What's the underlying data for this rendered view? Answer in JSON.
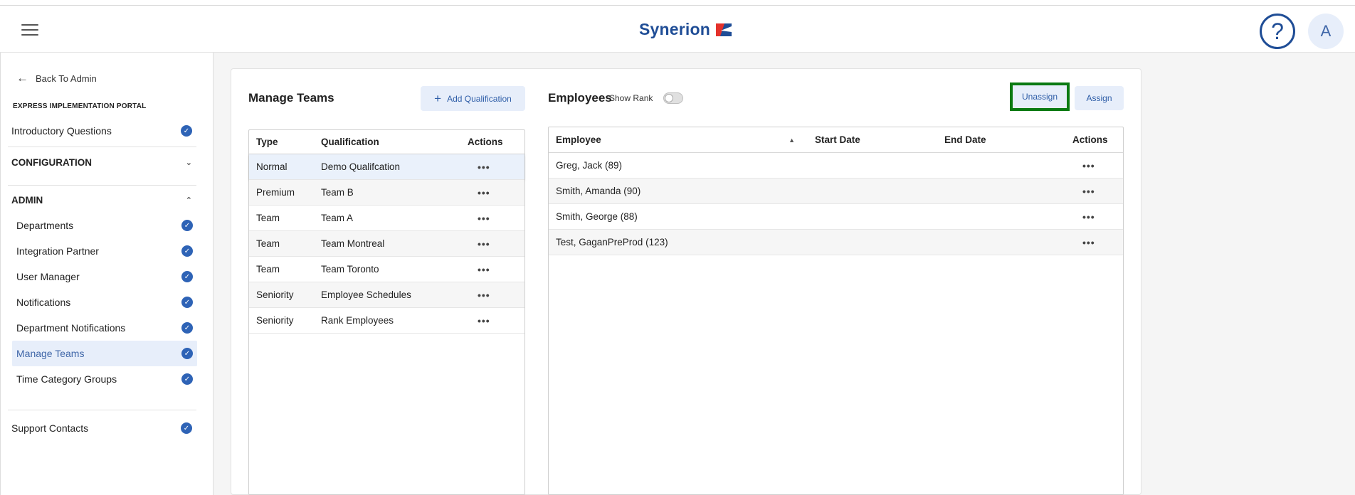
{
  "header": {
    "brand": "Synerion",
    "help_symbol": "?",
    "avatar_initial": "A",
    "brand_color": "#1f4d96"
  },
  "sidebar": {
    "back_label": "Back To Admin",
    "portal_label": "EXPRESS IMPLEMENTATION PORTAL",
    "introductory": "Introductory Questions",
    "configuration": "CONFIGURATION",
    "admin": "ADMIN",
    "admin_items": [
      {
        "label": "Departments",
        "done": true
      },
      {
        "label": "Integration Partner",
        "done": true
      },
      {
        "label": "User Manager",
        "done": true
      },
      {
        "label": "Notifications",
        "done": true
      },
      {
        "label": "Department Notifications",
        "done": true
      },
      {
        "label": "Manage Teams",
        "done": true,
        "active": true
      },
      {
        "label": "Time Category Groups",
        "done": true
      }
    ],
    "support": "Support Contacts",
    "check_mark": "✓"
  },
  "manage_teams": {
    "title": "Manage Teams",
    "add_button": "Add Qualification",
    "columns": [
      "Type",
      "Qualification",
      "Actions"
    ],
    "rows": [
      {
        "type": "Normal",
        "qualification": "Demo Qualifcation"
      },
      {
        "type": "Premium",
        "qualification": "Team B"
      },
      {
        "type": "Team",
        "qualification": "Team A"
      },
      {
        "type": "Team",
        "qualification": "Team Montreal"
      },
      {
        "type": "Team",
        "qualification": "Team Toronto"
      },
      {
        "type": "Seniority",
        "qualification": "Employee Schedules"
      },
      {
        "type": "Seniority",
        "qualification": "Rank Employees"
      }
    ],
    "actions_glyph": "•••"
  },
  "employees": {
    "title": "Employees",
    "show_rank_label": "Show Rank",
    "show_rank_on": false,
    "unassign_button": "Unassign",
    "assign_button": "Assign",
    "columns": [
      "Employee",
      "Start Date",
      "End Date",
      "Actions"
    ],
    "rows": [
      {
        "employee": "Greg, Jack (89)",
        "start": "",
        "end": ""
      },
      {
        "employee": "Smith, Amanda (90)",
        "start": "",
        "end": ""
      },
      {
        "employee": "Smith, George (88)",
        "start": "",
        "end": ""
      },
      {
        "employee": "Test, GaganPreProd (123)",
        "start": "",
        "end": ""
      }
    ],
    "actions_glyph": "•••"
  },
  "colors": {
    "accent": "#2f5ea8",
    "highlight_border": "#0a7a12",
    "active_bg": "#e7eefa"
  }
}
